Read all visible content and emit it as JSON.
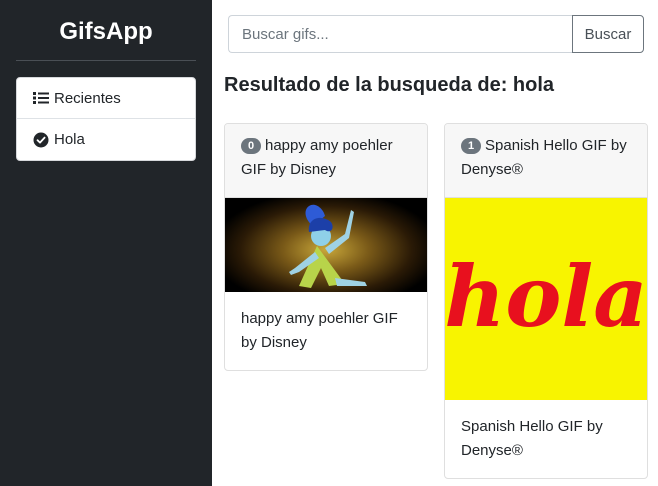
{
  "sidebar": {
    "brand": "GifsApp",
    "items": [
      {
        "label": "Recientes",
        "icon": "list-icon"
      },
      {
        "label": "Hola",
        "icon": "check-circle-icon"
      }
    ]
  },
  "search": {
    "placeholder": "Buscar gifs...",
    "value": "",
    "button_label": "Buscar"
  },
  "results": {
    "title": "Resultado de la busqueda de: hola",
    "cards": [
      {
        "index": "0",
        "title": "happy amy poehler GIF by Disney",
        "caption": "happy amy poehler GIF by Disney"
      },
      {
        "index": "1",
        "title": "Spanish Hello GIF by Denyse®",
        "caption": "Spanish Hello GIF by Denyse®",
        "image_text": "hola"
      }
    ]
  },
  "colors": {
    "sidebar_bg": "#212529",
    "badge_bg": "#6c757d",
    "hola_bg": "#f8f400",
    "hola_text": "#e8101e"
  }
}
